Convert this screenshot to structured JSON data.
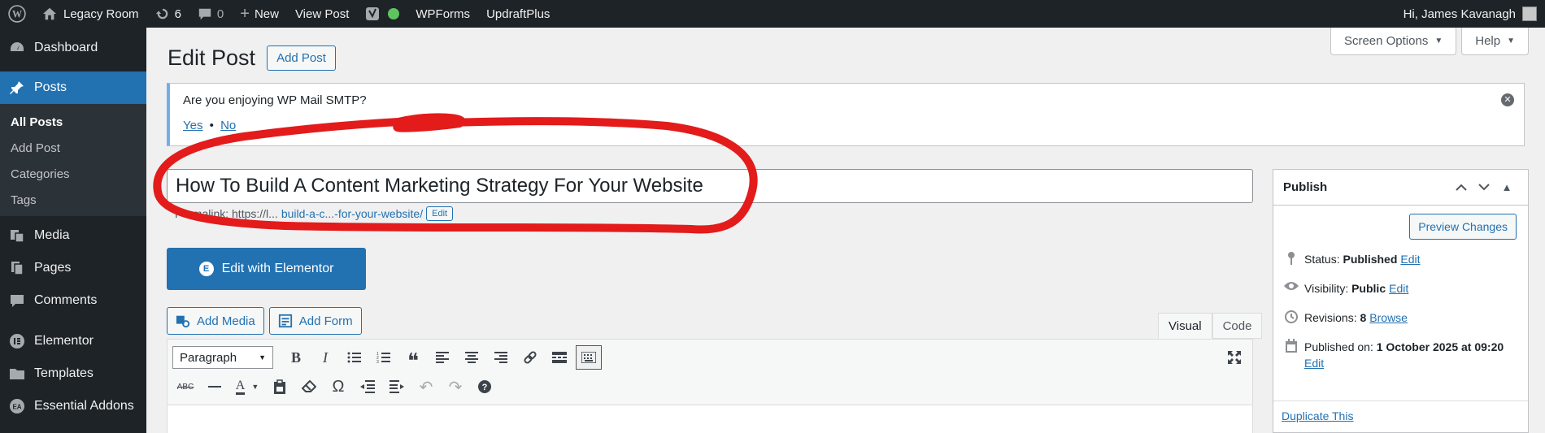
{
  "adminbar": {
    "site_name": "Legacy Room",
    "updates_count": "6",
    "comments_count": "0",
    "new_label": "New",
    "view_post_label": "View Post",
    "wpforms_label": "WPForms",
    "updraft_label": "UpdraftPlus",
    "greeting": "Hi, James Kavanagh"
  },
  "sidebar": {
    "items": [
      {
        "label": "Dashboard",
        "icon": "dashboard-icon"
      },
      {
        "label": "Posts",
        "icon": "pin-icon"
      },
      {
        "label": "Media",
        "icon": "media-icon"
      },
      {
        "label": "Pages",
        "icon": "pages-icon"
      },
      {
        "label": "Comments",
        "icon": "comments-icon"
      },
      {
        "label": "Elementor",
        "icon": "elementor-icon"
      },
      {
        "label": "Templates",
        "icon": "folder-icon"
      },
      {
        "label": "Essential Addons",
        "icon": "ea-icon"
      }
    ],
    "posts_submenu": [
      "All Posts",
      "Add Post",
      "Categories",
      "Tags"
    ]
  },
  "screen_meta": {
    "screen_options": "Screen Options",
    "help": "Help"
  },
  "page": {
    "title": "Edit Post",
    "add_post": "Add Post"
  },
  "notice": {
    "message": "Are you enjoying WP Mail SMTP?",
    "yes": "Yes",
    "separator": "•",
    "no": "No"
  },
  "post": {
    "title": "How To Build A Content Marketing Strategy For Your Website",
    "permalink_prefix": "Permalink: https://l...",
    "permalink_slug": "build-a-c...-for-your-website/",
    "permalink_edit": "Edit"
  },
  "editor": {
    "elementor_button": "Edit with Elementor",
    "add_media": "Add Media",
    "add_form": "Add Form",
    "tab_visual": "Visual",
    "tab_code": "Code",
    "format_select": "Paragraph"
  },
  "publish": {
    "heading": "Publish",
    "preview_changes": "Preview Changes",
    "status_label": "Status:",
    "status_value": "Published",
    "visibility_label": "Visibility:",
    "visibility_value": "Public",
    "revisions_label": "Revisions:",
    "revisions_value": "8",
    "browse": "Browse",
    "published_on_label": "Published on:",
    "published_on_value": "1 October 2025 at 09:20",
    "edit": "Edit",
    "duplicate": "Duplicate This"
  },
  "colors": {
    "adminbar_bg": "#1d2327",
    "accent": "#2271b1",
    "annotation": "#e31b1b"
  }
}
